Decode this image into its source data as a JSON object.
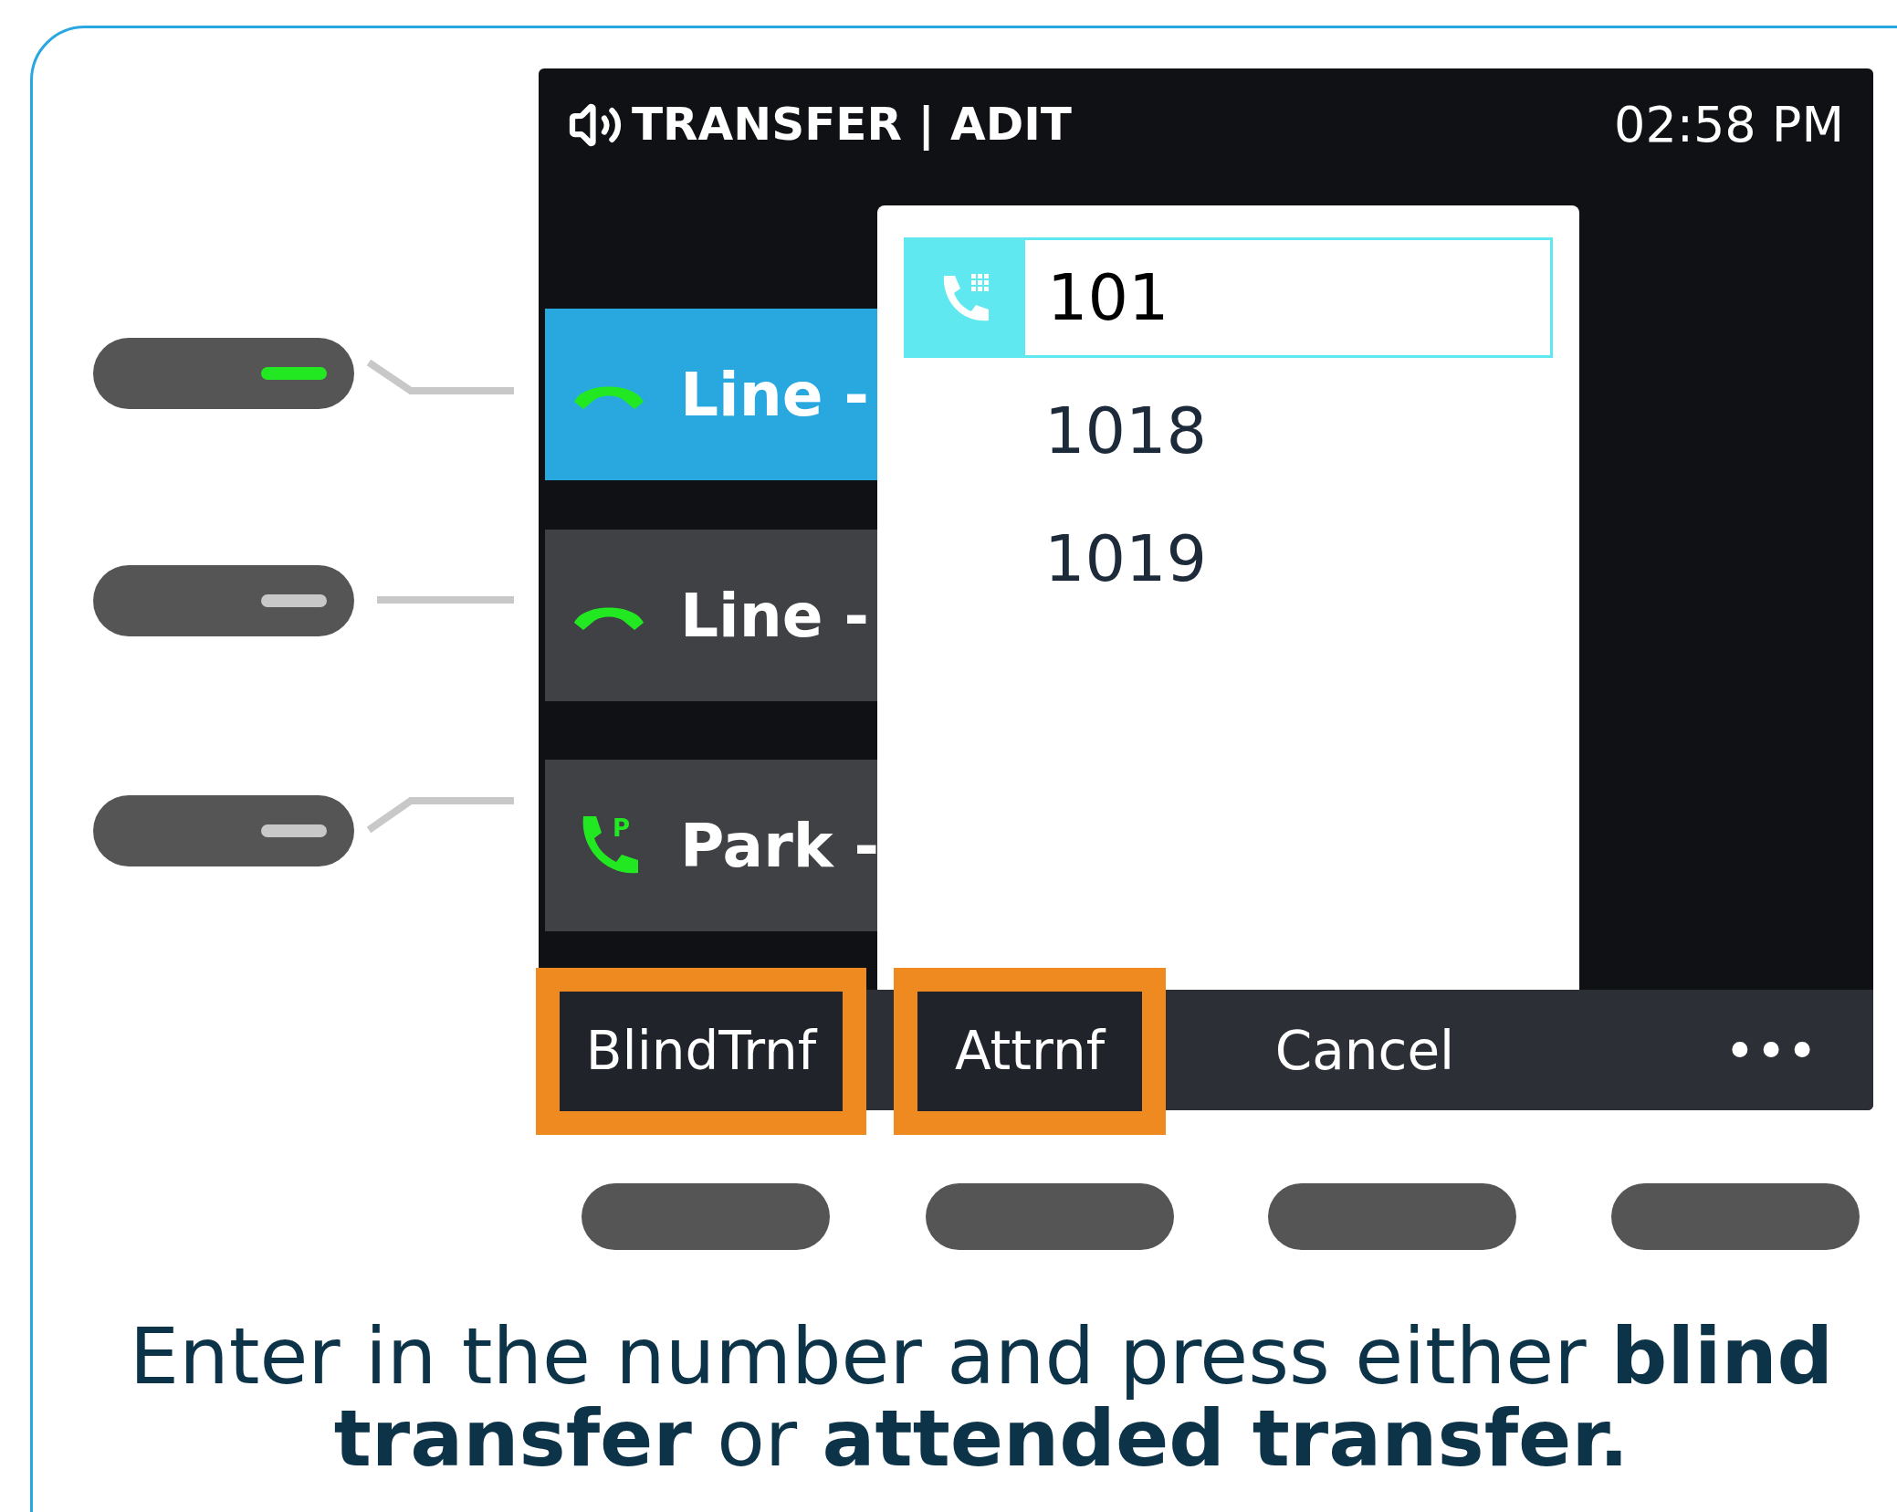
{
  "status_bar": {
    "title": "TRANSFER | ADIT",
    "time": "02:58 PM"
  },
  "line_keys": [
    {
      "kind": "line",
      "label": "Line -",
      "selected": true,
      "led_on": true
    },
    {
      "kind": "line",
      "label": "Line -",
      "selected": false,
      "led_on": false
    },
    {
      "kind": "park",
      "label": "Park -",
      "icon_letter": "P",
      "selected": false,
      "led_on": false
    }
  ],
  "dialer": {
    "value": "101",
    "suggestions": [
      "1018",
      "1019"
    ]
  },
  "softkeys": [
    {
      "label": "BlindTrnf",
      "highlighted": true
    },
    {
      "label": "Attrnf",
      "highlighted": true
    },
    {
      "label": "Cancel",
      "highlighted": false
    },
    {
      "label": "•••",
      "highlighted": false
    }
  ],
  "caption": "Enter in the number and press either **blind transfer** or **attended transfer.**"
}
